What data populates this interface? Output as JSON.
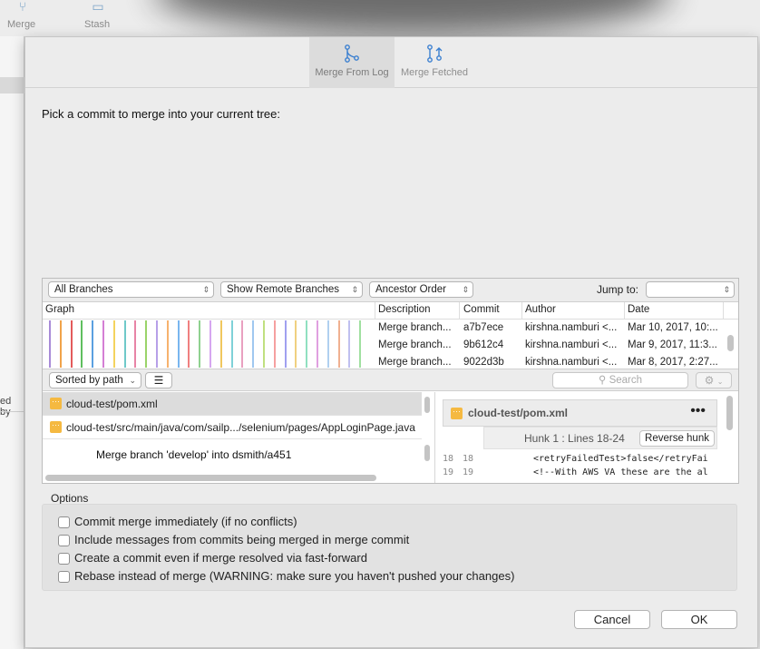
{
  "background_window": {
    "toolbar_buttons": [
      {
        "label": "Merge",
        "icon": "merge-icon"
      },
      {
        "label": "Stash",
        "icon": "stash-icon"
      }
    ],
    "side_text": "ed by"
  },
  "sheet": {
    "tabs": [
      {
        "label": "Merge From Log",
        "icon": "merge-icon",
        "active": true
      },
      {
        "label": "Merge Fetched",
        "icon": "merge-fetched-icon",
        "active": false
      }
    ],
    "prompt": "Pick a commit to merge into your current tree:"
  },
  "log": {
    "filters": {
      "branches": "All Branches",
      "remote": "Show Remote Branches",
      "order": "Ancestor Order",
      "jump_label": "Jump to:",
      "jump_value": ""
    },
    "columns": [
      "Graph",
      "Description",
      "Commit",
      "Author",
      "Date"
    ],
    "commits": [
      {
        "description": "Merge branch...",
        "commit": "a7b7ece",
        "author": "kirshna.namburi <...",
        "date": "Mar 10, 2017, 10:..."
      },
      {
        "description": "Merge branch...",
        "commit": "9b612c4",
        "author": "kirshna.namburi <...",
        "date": "Mar 9, 2017, 11:3..."
      },
      {
        "description": "Merge branch...",
        "commit": "9022d3b",
        "author": "kirshna.namburi <...",
        "date": "Mar 8, 2017, 2:27..."
      }
    ],
    "graph_colors": [
      "#a98bd8",
      "#f1a34a",
      "#e35b5b",
      "#5fbf5f",
      "#5aa0e0",
      "#d47fd4",
      "#f4d35e",
      "#6fc9c9",
      "#e884a6",
      "#9ad36a",
      "#b7a0e8",
      "#f7b26e",
      "#79b6ef",
      "#f08080",
      "#8fd18f",
      "#d6a6f0",
      "#f0c75e",
      "#7fd1d8",
      "#e9a0c0",
      "#a0c8f0",
      "#c0e080",
      "#f6a0a0",
      "#a0a0f0",
      "#f0d080",
      "#90e0c0",
      "#e0a0e0",
      "#b0d0f0",
      "#f0b090",
      "#c0c0f0",
      "#a0e0a0"
    ]
  },
  "files": {
    "sort_label": "Sorted by path",
    "list_icon": "list-view-icon",
    "search_placeholder": "Search",
    "items": [
      {
        "path": "cloud-test/pom.xml",
        "selected": true
      },
      {
        "path": "cloud-test/src/main/java/com/sailp.../selenium/pages/AppLoginPage.java",
        "selected": false
      }
    ],
    "commit_message": "Merge branch 'develop' into dsmith/a451"
  },
  "diff": {
    "file": "cloud-test/pom.xml",
    "hunk_label": "Hunk 1 : Lines 18-24",
    "reverse_hunk_label": "Reverse hunk",
    "lines": [
      {
        "old": "18",
        "new": "18",
        "code": "<retryFailedTest>false</retryFai"
      },
      {
        "old": "19",
        "new": "19",
        "code": "<!--With AWS VA these are the al"
      }
    ]
  },
  "options": {
    "title": "Options",
    "items": [
      {
        "label": "Commit merge immediately (if no conflicts)",
        "checked": false
      },
      {
        "label": "Include messages from commits being merged in merge commit",
        "checked": false
      },
      {
        "label": "Create a commit even if merge resolved via fast-forward",
        "checked": false
      },
      {
        "label": "Rebase instead of merge (WARNING: make sure you haven't pushed your changes)",
        "checked": false
      }
    ]
  },
  "buttons": {
    "cancel": "Cancel",
    "ok": "OK"
  }
}
